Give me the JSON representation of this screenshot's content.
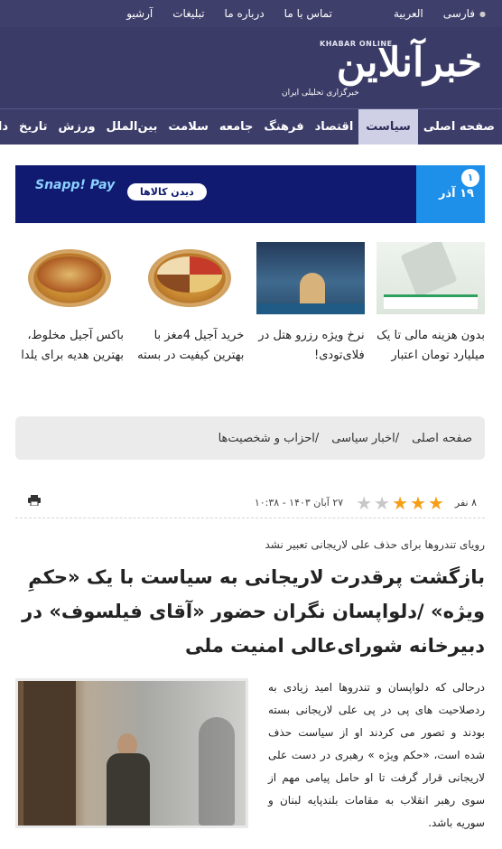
{
  "topbar": {
    "languages": [
      "فارسی",
      "العربیة"
    ],
    "links": [
      "تماس با ما",
      "درباره ما",
      "تبلیغات",
      "آرشیو"
    ]
  },
  "header": {
    "logo_en": "KHABAR ONLINE",
    "logo_fa": "خبرآنلاین",
    "tagline": "خبرگزاری تحلیلی ایران"
  },
  "nav": {
    "items": [
      "صفحه اصلی",
      "سیاست",
      "اقتصاد",
      "فرهنگ",
      "جامعه",
      "سلامت",
      "بین‌الملل",
      "ورزش",
      "تاریخ",
      "دانش"
    ],
    "active": "سیاست"
  },
  "banner": {
    "badge": "۱",
    "date": "۱۹ آذر",
    "cta": "دیدن کالاها",
    "brand": "Snapp! Pay"
  },
  "ads": [
    {
      "caption": "بدون هزینه مالی تا یک میلیارد تومان اعتبار",
      "image": "calculator-promo"
    },
    {
      "caption": "نرخ ویژه رزرو هتل در فلای‌تودی!",
      "image": "hotel-dubai"
    },
    {
      "caption": "خرید آجیل 4مغز با بهترین کیفیت در بسته",
      "image": "nut-basket"
    },
    {
      "caption": "باکس آجیل مخلوط، بهترین هدیه برای یلدا",
      "image": "mixed-nut-box"
    }
  ],
  "breadcrumb": {
    "items": [
      "صفحه اصلی",
      "اخبار سیاسی",
      "احزاب و شخصیت‌ها"
    ]
  },
  "meta": {
    "count": "۸ نفر",
    "rating": 3,
    "rating_max": 5,
    "date": "۲۷ آبان ۱۴۰۳ - ۱۰:۳۸",
    "print_icon": "printer-icon"
  },
  "article": {
    "kicker": "رویای تندروها برای حذف علی لاریجانی تعبیر نشد",
    "title": "بازگشت پرقدرت لاریجانی به سیاست با یک «حکمِ ویژه» /دلواپسان نگران حضور «آقای فیلسوف» در دبیرخانه شورای‌عالی امنیت ملی",
    "lead": "درحالی که دلواپسان و تندروها امید زیادی به ردصلاحیت های پی در پی علی لاریجانی بسته بودند و تصور می کردند او از سیاست حذف شده است، «حکم ویژه » رهبری در دست علی لاریجانی قرار گرفت تا او حامل پیامی مهم از سوی رهبر انقلاب به مقامات بلندپایه لبنان و سوریه باشد."
  },
  "colors": {
    "header_bg": "#3b3b67",
    "nav_active_bg": "#cfd0e6",
    "banner_bg": "#0f1a70",
    "banner_date_bg": "#1e90ea",
    "star_on": "#f59f18",
    "star_off": "#c8c8c8"
  }
}
